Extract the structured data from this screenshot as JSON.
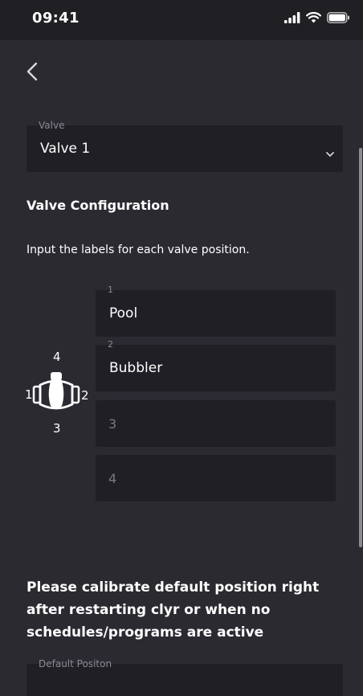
{
  "status_bar": {
    "time": "09:41",
    "icons": [
      "signal-icon",
      "wifi-icon",
      "battery-icon"
    ]
  },
  "nav": {
    "back_icon": "chevron-left-icon"
  },
  "valve_select": {
    "label": "Valve",
    "value": "Valve 1",
    "icon": "chevron-down-icon"
  },
  "section": {
    "title": "Valve Configuration",
    "instruction": "Input the labels for each valve position."
  },
  "valve_diagram": {
    "icon": "valve-handle-icon",
    "labels": {
      "top": "4",
      "left": "1",
      "right": "2",
      "bottom": "3"
    }
  },
  "positions": [
    {
      "label": "1",
      "value": "Pool",
      "placeholder": ""
    },
    {
      "label": "2",
      "value": "Bubbler",
      "placeholder": ""
    },
    {
      "label": "",
      "value": "",
      "placeholder": "3"
    },
    {
      "label": "",
      "value": "",
      "placeholder": "4"
    }
  ],
  "calibration": {
    "message": "Please calibrate default position right after restarting clyr or when no schedules/programs are active",
    "default_position_label": "Default Positon"
  },
  "colors": {
    "background": "#2b2a31",
    "field": "#1f1f25",
    "status_bar": "#1f1f24",
    "muted_text": "#8b8a92",
    "text": "#ffffff"
  }
}
